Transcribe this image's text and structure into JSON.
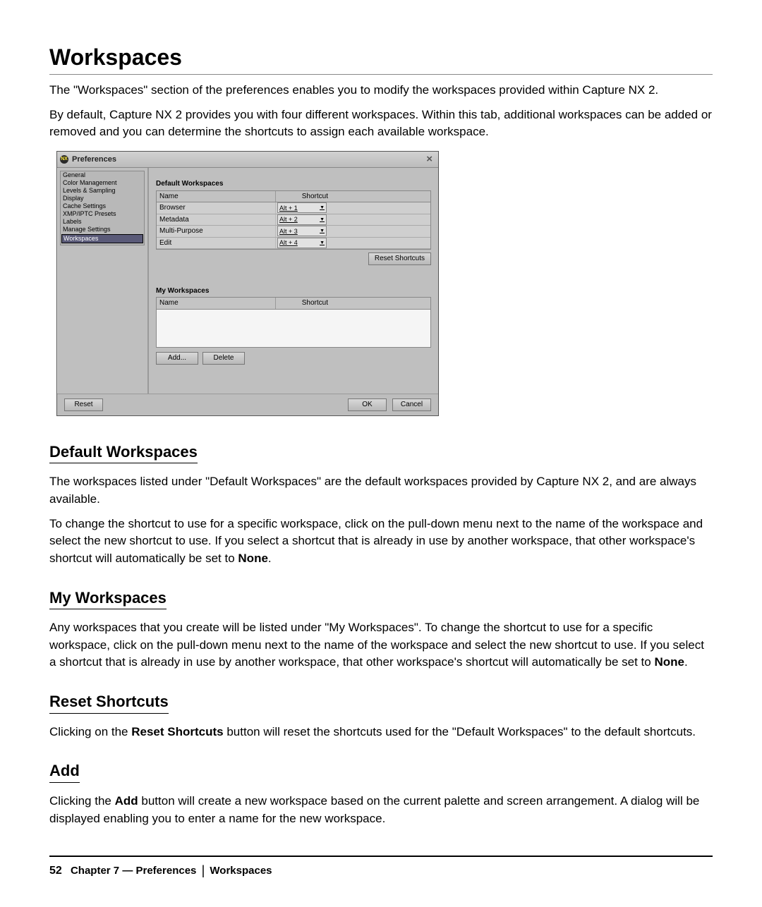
{
  "heading": "Workspaces",
  "intro1": "The \"Workspaces\" section of the preferences enables you to modify the workspaces provided within Capture NX 2.",
  "intro2": "By default, Capture NX 2 provides you with four different workspaces. Within this tab, additional workspaces can be added or removed and you can determine the shortcuts to assign each available workspace.",
  "dialog": {
    "title": "Preferences",
    "app_icon_text": "NX",
    "close_glyph": "×",
    "sidebar": {
      "items": [
        {
          "label": "General"
        },
        {
          "label": "Color Management"
        },
        {
          "label": "Levels & Sampling"
        },
        {
          "label": "Display"
        },
        {
          "label": "Cache Settings"
        },
        {
          "label": "XMP/IPTC Presets"
        },
        {
          "label": "Labels"
        },
        {
          "label": "Manage Settings"
        },
        {
          "label": "Workspaces"
        }
      ],
      "selected_index": 8
    },
    "default_ws": {
      "label": "Default Workspaces",
      "col_name": "Name",
      "col_short": "Shortcut",
      "rows": [
        {
          "name": "Browser",
          "shortcut": "Alt + 1"
        },
        {
          "name": "Metadata",
          "shortcut": "Alt + 2"
        },
        {
          "name": "Multi-Purpose",
          "shortcut": "Alt + 3"
        },
        {
          "name": "Edit",
          "shortcut": "Alt + 4"
        }
      ],
      "reset_label": "Reset Shortcuts"
    },
    "my_ws": {
      "label": "My Workspaces",
      "col_name": "Name",
      "col_short": "Shortcut",
      "add_label": "Add...",
      "delete_label": "Delete"
    },
    "footer": {
      "reset": "Reset",
      "ok": "OK",
      "cancel": "Cancel"
    }
  },
  "sec_default": {
    "title": "Default Workspaces",
    "p1": "The workspaces listed under \"Default Workspaces\" are the default workspaces provided by Capture NX 2, and are always available.",
    "p2_a": "To change the shortcut to use for a specific workspace, click on the pull-down menu next to the name of the workspace and select the new shortcut to use. If you select a shortcut that is already in use by another workspace, that other workspace's shortcut will automatically be set to ",
    "p2_bold": "None",
    "p2_b": "."
  },
  "sec_my": {
    "title": "My Workspaces",
    "p_a": "Any workspaces that you create will be listed under \"My Workspaces\". To change the shortcut to use for a specific workspace, click on the pull-down menu next to the name of the workspace and select the new shortcut to use. If you select a shortcut that is already in use by another workspace, that other workspace's shortcut will automatically be set to ",
    "p_bold": "None",
    "p_b": "."
  },
  "sec_reset": {
    "title": "Reset Shortcuts",
    "p_a": "Clicking on the ",
    "p_bold": "Reset Shortcuts",
    "p_b": " button will reset the shortcuts used for the \"Default Workspaces\" to the default shortcuts."
  },
  "sec_add": {
    "title": "Add",
    "p_a": "Clicking the ",
    "p_bold": "Add",
    "p_b": " button will create a new workspace based on the current palette and screen arrangement. A dialog will be displayed enabling you to enter a name for the new workspace."
  },
  "footer_line": {
    "page": "52",
    "chapter": "Chapter 7 — Preferences",
    "section": "Workspaces"
  }
}
